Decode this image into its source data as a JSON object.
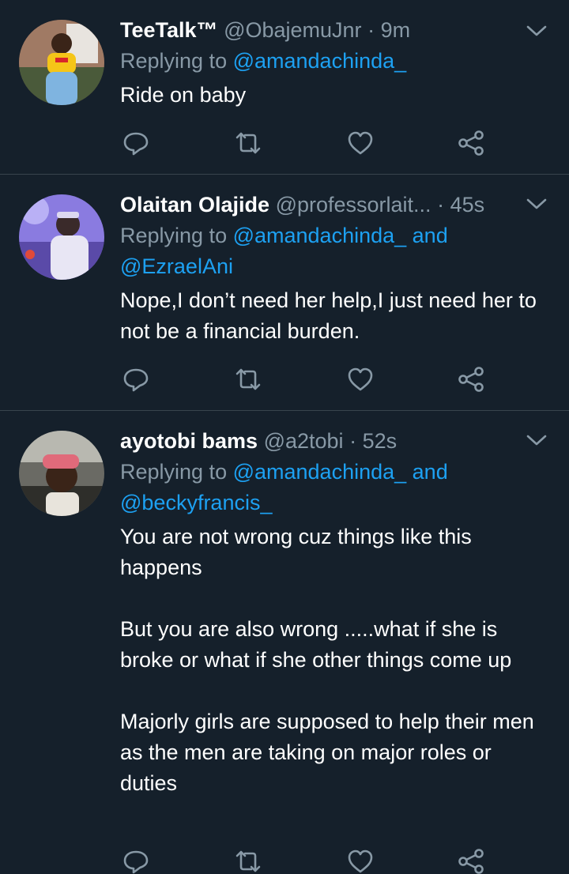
{
  "tweets": [
    {
      "name": "TeeTalk™",
      "handle": "@ObajemuJnr",
      "dot": "·",
      "time": "9m",
      "replying_prefix": "Replying to ",
      "mentions": [
        "@amandachinda_"
      ],
      "mention_joiner": "",
      "text": "Ride on baby",
      "avatar_icon": "profile-photo-woman-yellow-top"
    },
    {
      "name": "Olaitan Olajide",
      "handle": "@professorlait...",
      "dot": "·",
      "time": "45s",
      "replying_prefix": "Replying to ",
      "mentions": [
        "@amandachinda_",
        "@EzraelAni"
      ],
      "mention_joiner": " and",
      "text": "Nope,I don’t need her help,I just need her to not be a financial burden.",
      "avatar_icon": "profile-photo-man-purple-light"
    },
    {
      "name": "ayotobi bams",
      "handle": "@a2tobi",
      "dot": "·",
      "time": "52s",
      "replying_prefix": "Replying to ",
      "mentions": [
        "@amandachinda_",
        "@beckyfrancis_"
      ],
      "mention_joiner": " and",
      "text": "You are not wrong cuz things like this happens\n\nBut you are also wrong .....what if she is broke or what if she other things come up\n\nMajorly girls are supposed to help their men as the men are taking on major roles or duties",
      "avatar_icon": "profile-photo-man-cap-car"
    }
  ],
  "action_icons": [
    "reply-icon",
    "retweet-icon",
    "like-icon",
    "share-icon"
  ],
  "colors": {
    "background": "#15202b",
    "divider": "#38444d",
    "secondary_text": "#8899a6",
    "link": "#1da1f2"
  }
}
